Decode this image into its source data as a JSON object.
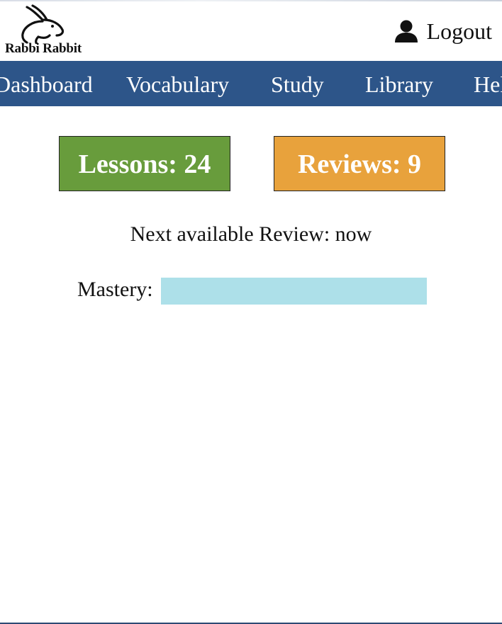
{
  "app": {
    "logo_text": "Rabbi Rabbit"
  },
  "header": {
    "logout_label": "Logout",
    "logout_icon": "user-icon"
  },
  "nav": {
    "items": [
      {
        "label": "Dashboard"
      },
      {
        "label": "Vocabulary"
      },
      {
        "label": "Study"
      },
      {
        "label": "Library"
      },
      {
        "label": "Help"
      }
    ]
  },
  "counters": {
    "lessons_label": "Lessons: 24",
    "reviews_label": "Reviews: 9"
  },
  "status": {
    "next_review": "Next available Review: now",
    "mastery_label": "Mastery:"
  },
  "colors": {
    "nav_background": "#2d5589",
    "lessons": "#689c3c",
    "reviews": "#e8a23c",
    "mastery_bar": "#ade0e9"
  }
}
